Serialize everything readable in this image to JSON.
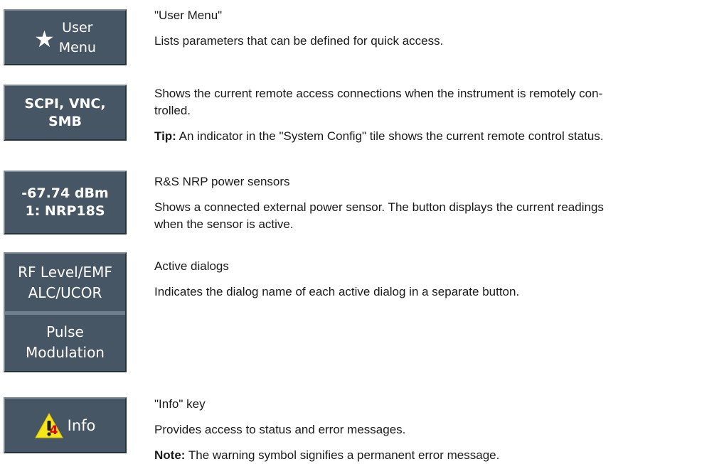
{
  "items": [
    {
      "button": {
        "line1": "User",
        "line2": "Menu",
        "icon": "star-icon"
      },
      "heading": "\"User Menu\"",
      "text": "Lists parameters that can be defined for quick access."
    },
    {
      "button": {
        "line1": "SCPI, VNC,",
        "line2": "SMB"
      },
      "text_line1": "Shows the current remote access connections when the instrument is remotely con-",
      "text_line2": "trolled.",
      "tip_label": "Tip:",
      "tip_text": " An indicator in the \"System Config\" tile shows the current remote control status."
    },
    {
      "button": {
        "line1": "-67.74 dBm",
        "line2": "1: NRP18S"
      },
      "heading": "R&S NRP power sensors",
      "text_line1": "Shows a connected external power sensor. The button displays the current readings",
      "text_line2": "when the sensor is active."
    },
    {
      "button": {
        "part1_line1": "RF Level/EMF",
        "part1_line2": "ALC/UCOR",
        "part2_line1": "Pulse",
        "part2_line2": "Modulation"
      },
      "heading": "Active dialogs",
      "text": "Indicates the dialog name of each active dialog in a separate button."
    },
    {
      "button": {
        "label": "Info",
        "badge": "4",
        "icon": "warning-icon"
      },
      "heading": "\"Info\" key",
      "text": "Provides access to status and error messages.",
      "note_label": "Note:",
      "note_text": " The warning symbol signifies a permanent error message."
    }
  ],
  "colors": {
    "button_bg": "#465664",
    "warning_yellow": "#f5e61a",
    "badge_red": "#e00000"
  }
}
